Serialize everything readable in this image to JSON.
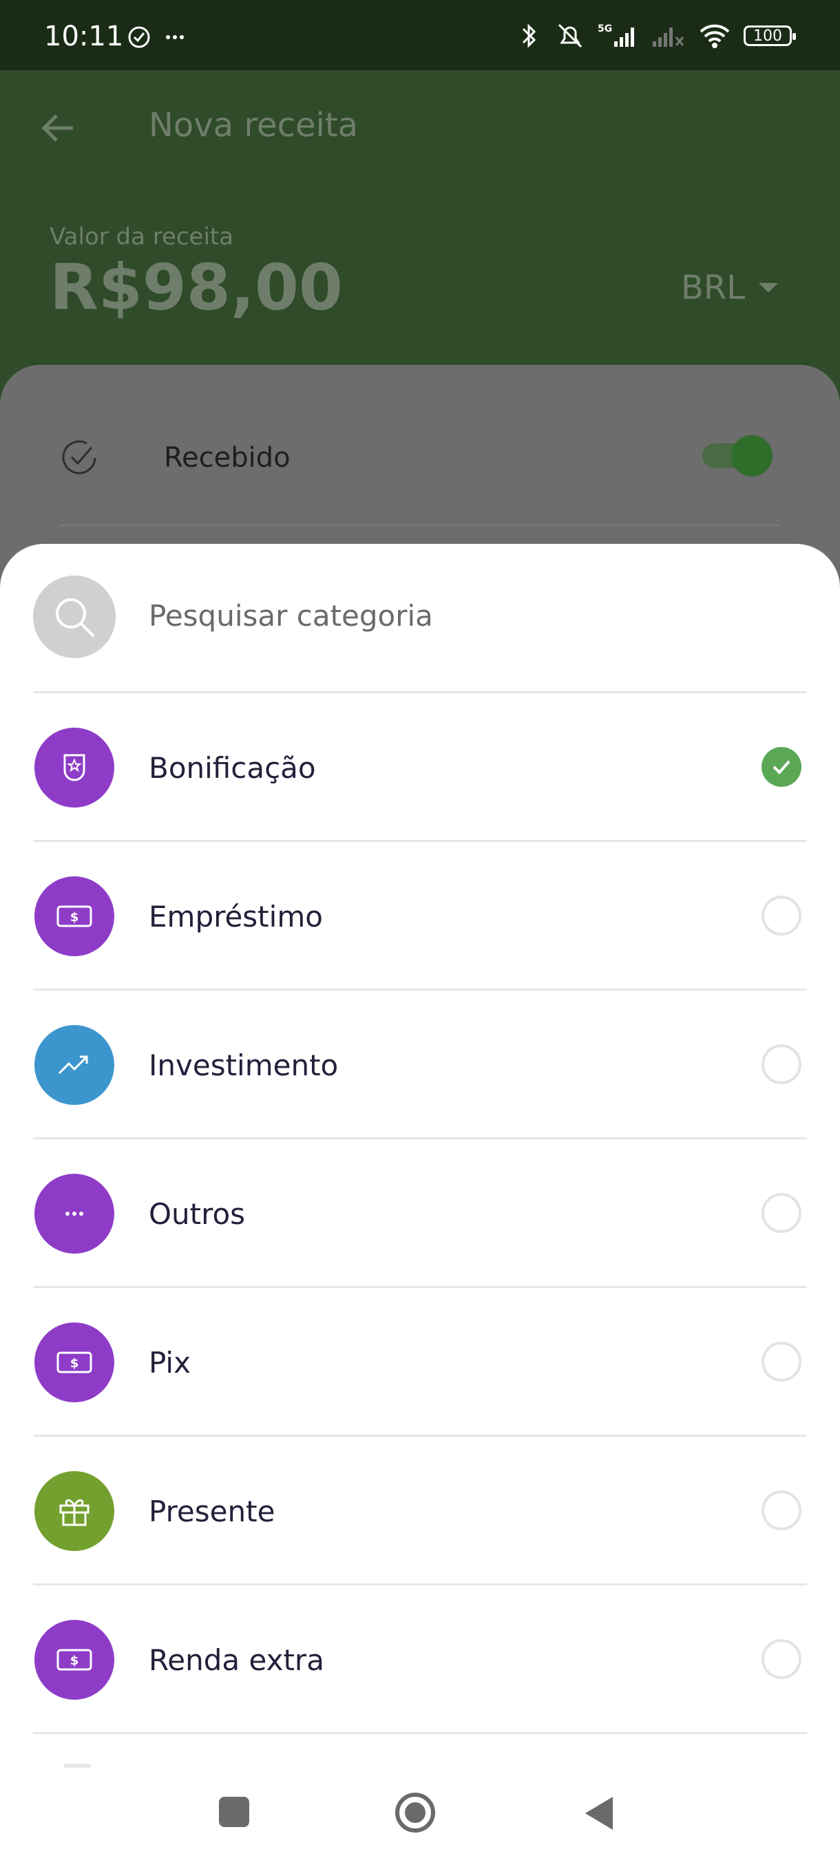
{
  "status_bar": {
    "time": "10:11",
    "battery": "100",
    "network": "5G"
  },
  "header": {
    "title": "Nova receita",
    "amount_label": "Valor da receita",
    "amount": "R$98,00",
    "currency": "BRL"
  },
  "form": {
    "recebido_label": "Recebido",
    "recebido_on": true
  },
  "sheet": {
    "search_placeholder": "Pesquisar categoria",
    "categories": [
      {
        "label": "Bonificação",
        "icon": "badge-star-icon",
        "color": "#8e3cc8",
        "selected": true
      },
      {
        "label": "Empréstimo",
        "icon": "money-bill-icon",
        "color": "#8e3cc8",
        "selected": false
      },
      {
        "label": "Investimento",
        "icon": "trending-up-icon",
        "color": "#3d95cd",
        "selected": false
      },
      {
        "label": "Outros",
        "icon": "more-dots-icon",
        "color": "#8e3cc8",
        "selected": false
      },
      {
        "label": "Pix",
        "icon": "money-bill-icon",
        "color": "#8e3cc8",
        "selected": false
      },
      {
        "label": "Presente",
        "icon": "gift-icon",
        "color": "#74a02f",
        "selected": false
      },
      {
        "label": "Renda extra",
        "icon": "money-bill-icon",
        "color": "#8e3cc8",
        "selected": false
      }
    ]
  },
  "colors": {
    "selected_check": "#5aa856",
    "header_bg": "#2f4b29",
    "status_bg": "#1b2c16"
  }
}
